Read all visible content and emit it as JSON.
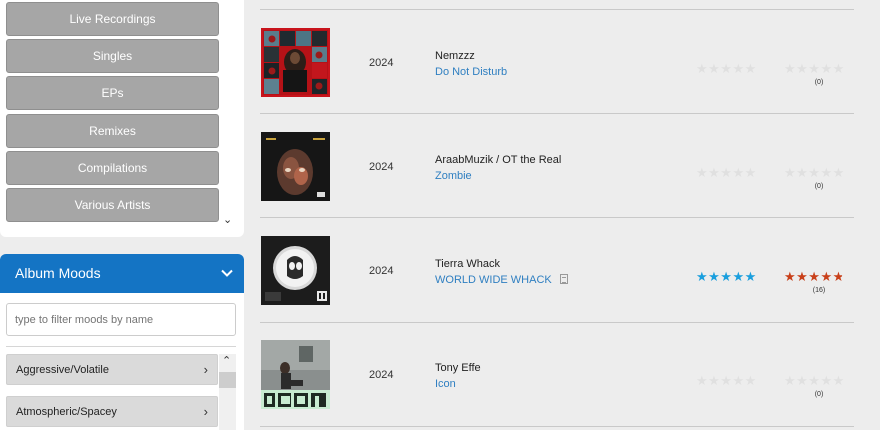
{
  "sidebar": {
    "filter_buttons": [
      {
        "label": "Live Recordings"
      },
      {
        "label": "Singles"
      },
      {
        "label": "EPs"
      },
      {
        "label": "Remixes"
      },
      {
        "label": "Compilations"
      },
      {
        "label": "Various Artists"
      }
    ],
    "scroll_down_glyph": "⌄",
    "moods": {
      "title": "Album Moods",
      "filter_placeholder": "type to filter moods by name",
      "items": [
        {
          "label": "Aggressive/Volatile"
        },
        {
          "label": "Atmospheric/Spacey"
        }
      ],
      "scroll_up_glyph": "⌃"
    }
  },
  "albums": [
    {
      "year": "2024",
      "artist": "Nemzzz",
      "title": "Do Not Disturb",
      "critic_rating": 0,
      "user_rating": 0,
      "user_count": "(0)",
      "has_review": false
    },
    {
      "year": "2024",
      "artist": "AraabMuzik / OT the Real",
      "title": "Zombie",
      "critic_rating": 0,
      "user_rating": 0,
      "user_count": "(0)",
      "has_review": false
    },
    {
      "year": "2024",
      "artist": "Tierra Whack",
      "title": "WORLD WIDE WHACK",
      "critic_rating": 4.5,
      "user_rating": 4,
      "user_count": "(16)",
      "has_review": true
    },
    {
      "year": "2024",
      "artist": "Tony Effe",
      "title": "Icon",
      "critic_rating": 0,
      "user_rating": 0,
      "user_count": "(0)",
      "has_review": false
    }
  ],
  "colors": {
    "accent": "#1474c4",
    "critic_star": "#1a9fde",
    "user_star": "#c9401a",
    "link": "#2f7fc1"
  },
  "icons": {
    "star": "★",
    "chevron_right": "›"
  }
}
